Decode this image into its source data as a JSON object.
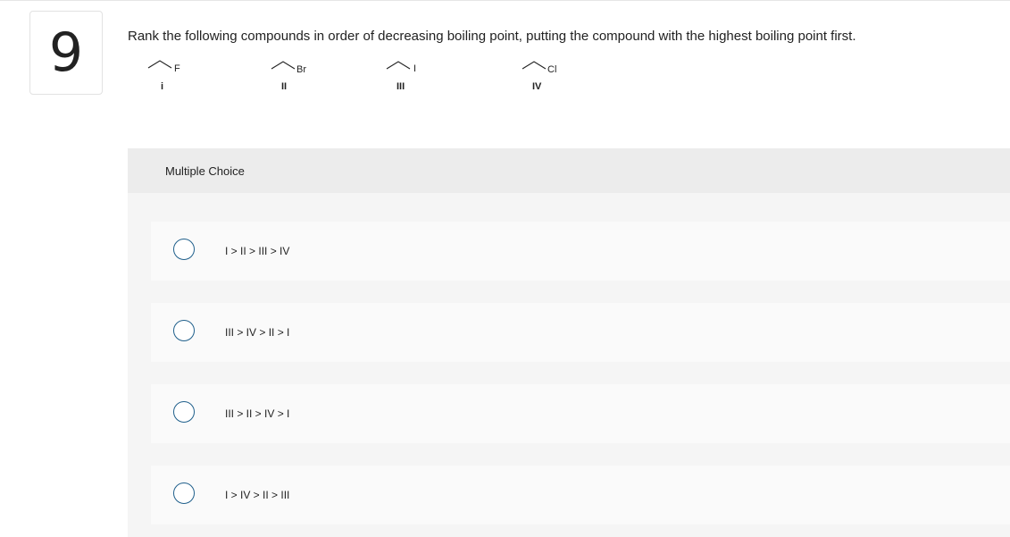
{
  "question": {
    "number": "9",
    "prompt": "Rank the following compounds in order of decreasing boiling point, putting the compound with the highest boiling point first."
  },
  "compounds": [
    {
      "halogen": "F",
      "label": "i"
    },
    {
      "halogen": "Br",
      "label": "II"
    },
    {
      "halogen": "I",
      "label": "III"
    },
    {
      "halogen": "Cl",
      "label": "IV"
    }
  ],
  "multiple_choice": {
    "title": "Multiple Choice",
    "options": [
      {
        "label": "I > II > III > IV"
      },
      {
        "label": "III > IV > II > I"
      },
      {
        "label": "III > II > IV > I"
      },
      {
        "label": "I > IV > II > III"
      }
    ]
  }
}
